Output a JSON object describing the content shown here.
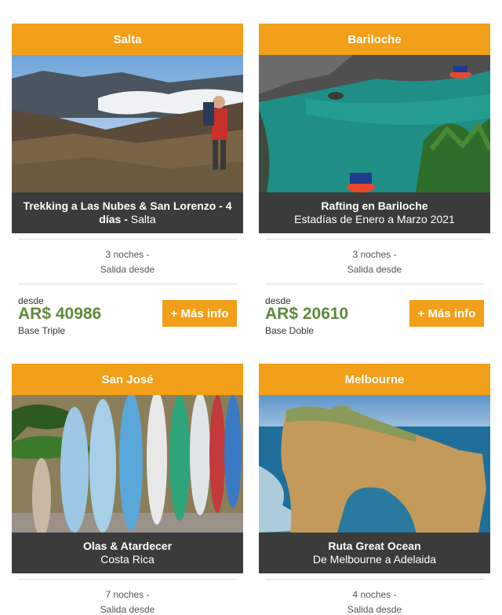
{
  "cards": [
    {
      "destination": "Salta",
      "title": "Trekking a Las Nubes & San Lorenzo - 4 días -",
      "title_suffix": " Salta",
      "subtitle": "",
      "nights": "3 noches -",
      "departure": "Salida desde",
      "from_label": "desde",
      "price": "AR$ 40986",
      "base": "Base Triple",
      "button": "+ Más info"
    },
    {
      "destination": "Bariloche",
      "title": "Rafting en Bariloche",
      "title_suffix": "",
      "subtitle": "Estadías de Enero a Marzo 2021",
      "nights": "3 noches -",
      "departure": "Salida desde",
      "from_label": "desde",
      "price": "AR$ 20610",
      "base": "Base Doble",
      "button": "+ Más info"
    },
    {
      "destination": "San José",
      "title": "Olas & Atardecer",
      "title_suffix": "",
      "subtitle": "Costa Rica",
      "nights": "7 noches -",
      "departure": "Salida desde"
    },
    {
      "destination": "Melbourne",
      "title": "Ruta Great Ocean",
      "title_suffix": "",
      "subtitle": "De Melbourne a Adelaida",
      "nights": "4 noches -",
      "departure": "Salida desde"
    }
  ],
  "colors": {
    "accent": "#f29f19",
    "caption_bg": "#3b3b3b",
    "price": "#5e8a3c"
  }
}
